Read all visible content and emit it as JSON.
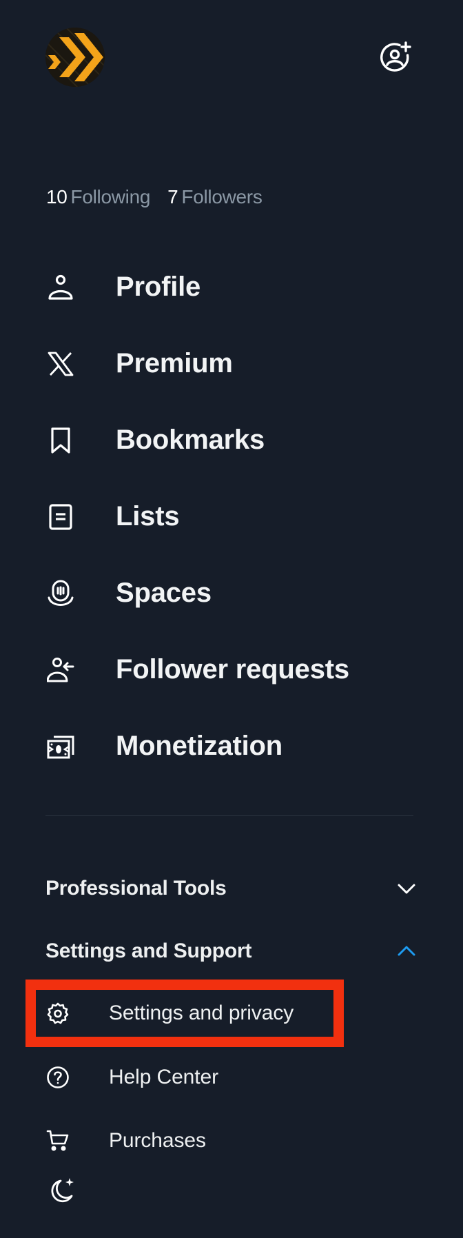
{
  "header": {
    "avatar_icon": "yellow-black-chevron-avatar",
    "add_account_icon": "account-add-icon"
  },
  "stats": {
    "following_count": "10",
    "following_label": "Following",
    "followers_count": "7",
    "followers_label": "Followers"
  },
  "nav": {
    "items": [
      {
        "label": "Profile",
        "icon": "person-icon"
      },
      {
        "label": "Premium",
        "icon": "x-logo-icon"
      },
      {
        "label": "Bookmarks",
        "icon": "bookmark-icon"
      },
      {
        "label": "Lists",
        "icon": "list-icon"
      },
      {
        "label": "Spaces",
        "icon": "spaces-icon"
      },
      {
        "label": "Follower requests",
        "icon": "follower-request-icon"
      },
      {
        "label": "Monetization",
        "icon": "money-icon"
      }
    ]
  },
  "sections": {
    "professional_tools": {
      "title": "Professional Tools",
      "expanded": false
    },
    "settings_support": {
      "title": "Settings and Support",
      "expanded": true,
      "items": [
        {
          "label": "Settings and privacy",
          "icon": "gear-icon",
          "highlighted": true
        },
        {
          "label": "Help Center",
          "icon": "help-icon"
        },
        {
          "label": "Purchases",
          "icon": "cart-icon"
        }
      ]
    }
  },
  "display_toggle_icon": "moon-star-icon",
  "colors": {
    "background": "#161d29",
    "text_primary": "#f2f4f5",
    "text_secondary": "#8b98a5",
    "accent": "#1d9bf0",
    "highlight": "#f2300f",
    "avatar_yellow": "#f3a31a"
  }
}
